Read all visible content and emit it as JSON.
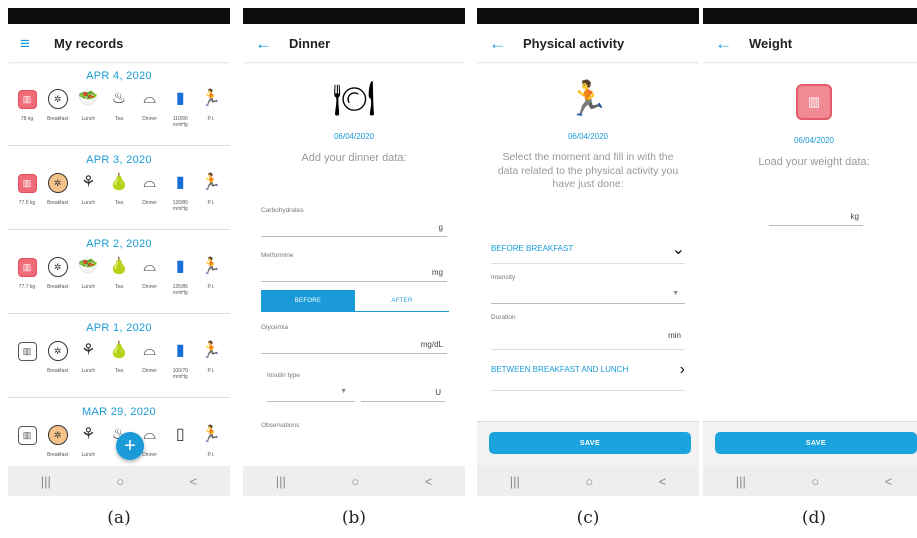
{
  "panel_a": {
    "title": "My records",
    "menu_icon": "≡",
    "fab": "+",
    "caption": "(a)",
    "days": [
      {
        "date": "APR 4, 2020",
        "labels": [
          "78 kg",
          "Breakfast",
          "Lunch",
          "Tea",
          "Dinner",
          "110/90\nmmHg",
          "P.I."
        ]
      },
      {
        "date": "APR 3, 2020",
        "labels": [
          "77.5 kg",
          "Breakfast",
          "Lunch",
          "Tea",
          "Dinner",
          "120/80\nmmHg",
          "P.I."
        ]
      },
      {
        "date": "APR 2, 2020",
        "labels": [
          "77.7 kg",
          "Breakfast",
          "Lunch",
          "Tea",
          "Dinner",
          "135/85\nmmHg",
          "P.I."
        ]
      },
      {
        "date": "APR 1, 2020",
        "labels": [
          "",
          "Breakfast",
          "Lunch",
          "Tea",
          "Dinner",
          "100/70\nmmHg",
          "P.I."
        ]
      },
      {
        "date": "MAR 29, 2020",
        "labels": [
          "",
          "Breakfast",
          "Lunch",
          "",
          "Dinner",
          "",
          "P.I."
        ]
      }
    ]
  },
  "panel_b": {
    "title": "Dinner",
    "back_icon": "←",
    "caption": "(b)",
    "date": "06/04/2020",
    "subtitle": "Add your dinner data:",
    "carbs_label": "Carbohydrates",
    "carbs_unit": "g",
    "metformine_label": "Metformine",
    "metformine_unit": "mg",
    "before": "BEFORE",
    "after": "AFTER",
    "glycemia_label": "Glycemia",
    "glycemia_unit": "mg/dL",
    "insulin_label": "Insulin type",
    "insulin_unit": "U",
    "observations_label": "Observations"
  },
  "panel_c": {
    "title": "Physical activity",
    "back_icon": "←",
    "caption": "(c)",
    "date": "06/04/2020",
    "subtitle": "Select the moment and fill in with the data related to the physical activity you have just done:",
    "section1": "BEFORE BREAKFAST",
    "intensity_label": "Intensity",
    "duration_label": "Duration",
    "duration_unit": "min",
    "section2": "BETWEEN BREAKFAST AND LUNCH",
    "save": "SAVE"
  },
  "panel_d": {
    "title": "Weight",
    "back_icon": "←",
    "caption": "(d)",
    "date": "06/04/2020",
    "subtitle": "Load your weight data:",
    "unit": "kg",
    "save": "SAVE"
  },
  "navbar": {
    "recent": "|||",
    "home": "○",
    "back": "<"
  },
  "colors": {
    "accent": "#1a9bd7",
    "scale": "#f06b78"
  },
  "icons": [
    "scale-icon",
    "plate-icon",
    "lunch-icon",
    "tea-icon",
    "cloche-icon",
    "blood-pressure-icon",
    "runner-icon"
  ]
}
